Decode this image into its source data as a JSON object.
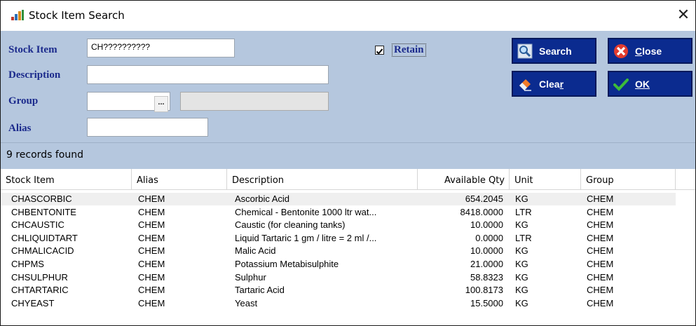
{
  "window": {
    "title": "Stock Item Search",
    "close_glyph": "✕",
    "icon": "app-icon"
  },
  "form": {
    "stock_item_label": "Stock Item",
    "stock_item_value": "CH??????????",
    "description_label": "Description",
    "description_value": "",
    "group_label": "Group",
    "group_value": "",
    "group_button": "...",
    "alias_label": "Alias",
    "alias_value": "",
    "retain_label": "Retain",
    "retain_checked": true
  },
  "buttons": {
    "search_label": "Search",
    "close_label_underlined": "C",
    "close_label_rest": "lose",
    "clear_label_main": "Clea",
    "clear_label_underlined": "r",
    "ok_label": "OK"
  },
  "status": {
    "text": "9 records found"
  },
  "table": {
    "columns": [
      "Stock Item",
      "Alias",
      "Description",
      "Available Qty",
      "Unit",
      "Group"
    ],
    "rows": [
      [
        "CHASCORBIC",
        "CHEM",
        "Ascorbic Acid",
        "654.2045",
        "KG",
        "CHEM"
      ],
      [
        "CHBENTONITE",
        "CHEM",
        "Chemical - Bentonite 1000 ltr wat...",
        "8418.0000",
        "LTR",
        "CHEM"
      ],
      [
        "CHCAUSTIC",
        "CHEM",
        "Caustic (for cleaning tanks)",
        "10.0000",
        "KG",
        "CHEM"
      ],
      [
        "CHLIQUIDTART",
        "CHEM",
        "Liquid Tartaric 1 gm / litre = 2 ml /...",
        "0.0000",
        "LTR",
        "CHEM"
      ],
      [
        "CHMALICACID",
        "CHEM",
        "Malic Acid",
        "10.0000",
        "KG",
        "CHEM"
      ],
      [
        "CHPMS",
        "CHEM",
        "Potassium Metabisulphite",
        "21.0000",
        "KG",
        "CHEM"
      ],
      [
        "CHSULPHUR",
        "CHEM",
        "Sulphur",
        "58.8323",
        "KG",
        "CHEM"
      ],
      [
        "CHTARTARIC",
        "CHEM",
        "Tartaric Acid",
        "100.8173",
        "KG",
        "CHEM"
      ],
      [
        "CHYEAST",
        "CHEM",
        "Yeast",
        "15.5000",
        "KG",
        "CHEM"
      ]
    ]
  },
  "colors": {
    "form_bg": "#b5c7de",
    "label_blue": "#1b2a8c",
    "button_bg": "#0b2b8f"
  }
}
